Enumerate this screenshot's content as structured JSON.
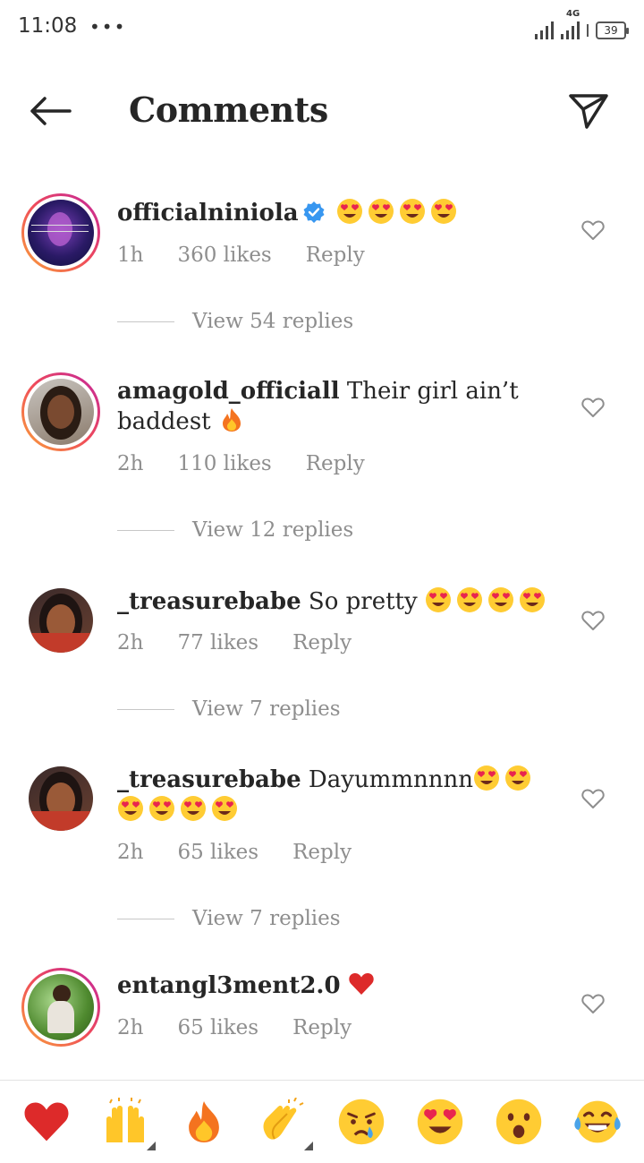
{
  "status_bar": {
    "time": "11:08",
    "dots": "•••",
    "network": "4G",
    "battery": "39"
  },
  "header": {
    "title": "Comments"
  },
  "comments": [
    {
      "username": "officialniniola",
      "verified": true,
      "text": "",
      "emojis": 4,
      "time": "1h",
      "likes": "360 likes",
      "reply": "Reply",
      "view_replies": "View 54 replies"
    },
    {
      "username": "amagold_officiall",
      "verified": false,
      "text": " Their girl ain’t baddest ",
      "time": "2h",
      "likes": "110 likes",
      "reply": "Reply",
      "view_replies": "View 12 replies"
    },
    {
      "username": "_treasurebabe",
      "verified": false,
      "text": " So pretty ",
      "time": "2h",
      "likes": "77 likes",
      "reply": "Reply",
      "view_replies": "View 7 replies"
    },
    {
      "username": "_treasurebabe",
      "verified": false,
      "text": " Dayummnnnn",
      "time": "2h",
      "likes": "65 likes",
      "reply": "Reply",
      "view_replies": "View 7 replies"
    },
    {
      "username": "entangl3ment2.0",
      "verified": false,
      "text": " ",
      "time": "2h",
      "likes": "65 likes",
      "reply": "Reply"
    }
  ],
  "reactions": [
    "red-heart",
    "raising-hands",
    "fire",
    "clapping-hands",
    "crying-face",
    "heart-eyes-face",
    "surprised-face",
    "tears-of-joy-face"
  ],
  "colors": {
    "text": "#262626",
    "secondary": "#8e8e8e",
    "verified_blue": "#3897f0",
    "story_ring": "#ef4a5a"
  }
}
